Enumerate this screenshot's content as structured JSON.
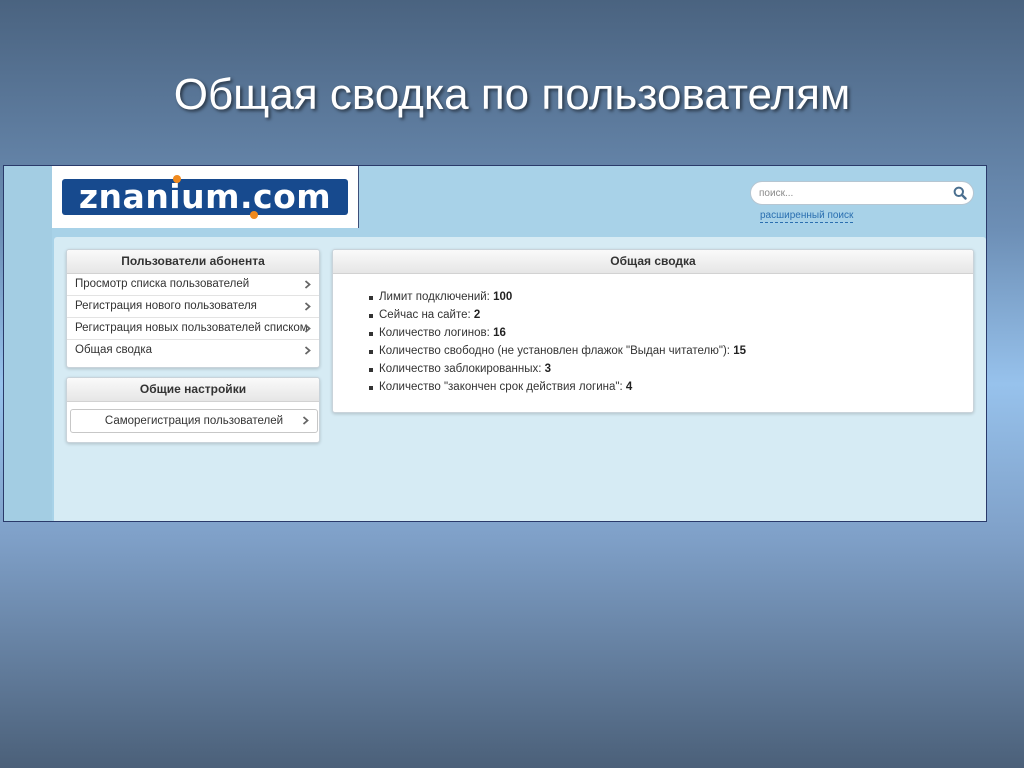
{
  "slide": {
    "title": "Общая сводка по пользователям"
  },
  "header": {
    "logo_text": "znanium.com",
    "logo_color": "#174a8e",
    "logo_accent": "#f08a1e",
    "search": {
      "placeholder": "поиск...",
      "icon": "search-icon"
    },
    "advanced_search": "расширенный поиск"
  },
  "sidebar": {
    "users_panel": {
      "title": "Пользователи абонента",
      "items": [
        {
          "label": "Просмотр списка пользователей"
        },
        {
          "label": "Регистрация нового пользователя"
        },
        {
          "label": "Регистрация новых пользователей списком"
        },
        {
          "label": "Общая сводка"
        }
      ]
    },
    "settings_panel": {
      "title": "Общие настройки",
      "button": "Саморегистрация пользователей"
    }
  },
  "main": {
    "title": "Общая сводка",
    "stats": [
      {
        "label": "Лимит подключений:",
        "value": "100"
      },
      {
        "label": "Сейчас на сайте:",
        "value": "2"
      },
      {
        "label": "Количество логинов:",
        "value": "16"
      },
      {
        "label": "Количество свободно (не установлен флажок \"Выдан читателю\"):",
        "value": "15"
      },
      {
        "label": "Количество заблокированных:",
        "value": "3"
      },
      {
        "label": "Количество \"закончен срок действия логина\":",
        "value": "4"
      }
    ]
  }
}
